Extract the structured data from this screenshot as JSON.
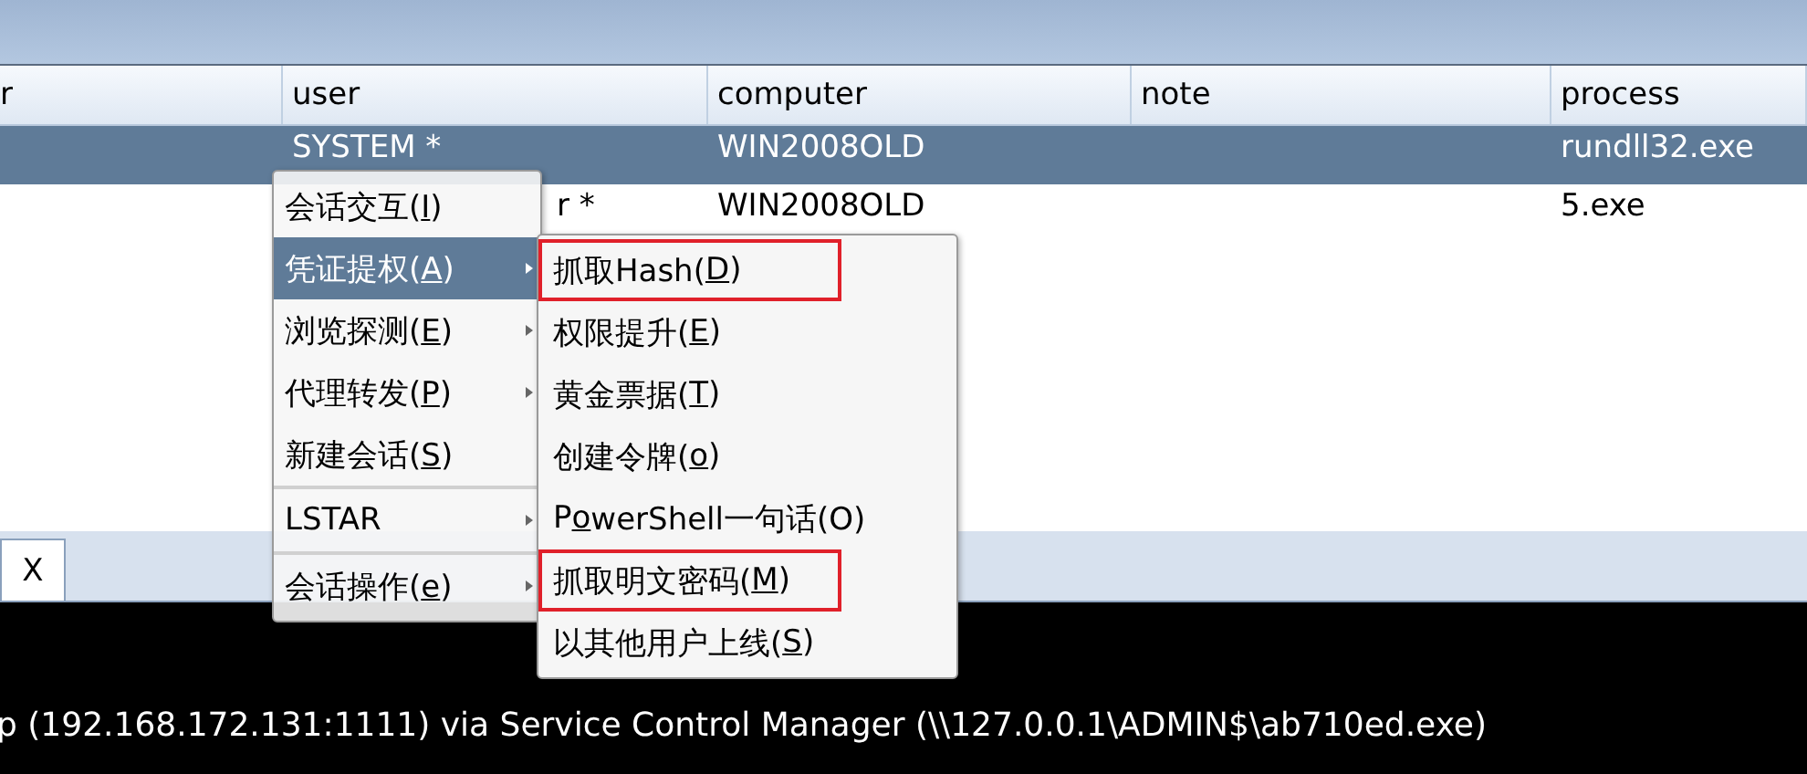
{
  "table": {
    "columns": [
      "r",
      "user",
      "computer",
      "note",
      "process"
    ],
    "rows": [
      {
        "selected": true,
        "cells": [
          "",
          "SYSTEM *",
          "WIN2008OLD",
          "",
          "rundll32.exe"
        ]
      },
      {
        "selected": false,
        "under_menu": true,
        "cells": [
          "",
          "r *",
          "WIN2008OLD",
          "",
          "5.exe"
        ]
      }
    ]
  },
  "tabs": [
    {
      "label": "X",
      "selected": true
    }
  ],
  "console": {
    "line": "p (192.168.172.131:1111) via Service Control Manager (\\\\127.0.0.1\\ADMIN$\\ab710ed.exe)"
  },
  "context_menu": {
    "items": [
      {
        "before": "会话交互(",
        "key": "I",
        "after": ")",
        "selected": false,
        "submenu": false,
        "separator_after": false
      },
      {
        "before": "凭证提权(",
        "key": "A",
        "after": ")",
        "selected": true,
        "submenu": true,
        "separator_after": false
      },
      {
        "before": "浏览探测(",
        "key": "E",
        "after": ")",
        "selected": false,
        "submenu": true,
        "separator_after": false
      },
      {
        "before": "代理转发(",
        "key": "P",
        "after": ")",
        "selected": false,
        "submenu": true,
        "separator_after": false
      },
      {
        "before": "新建会话(",
        "key": "S",
        "after": ")",
        "selected": false,
        "submenu": false,
        "separator_after": true
      },
      {
        "before": "LSTAR",
        "selected": false,
        "submenu": true,
        "separator_after": true
      },
      {
        "before": "会话操作(",
        "key": "e",
        "after": ")",
        "selected": false,
        "submenu": true,
        "separator_after": false
      }
    ]
  },
  "submenu": {
    "items": [
      {
        "before": "抓取Hash(",
        "key": "D",
        "after": ")",
        "marked": true
      },
      {
        "before": "权限提升(",
        "key": "E",
        "after": ")",
        "marked": false
      },
      {
        "before": "黄金票据(",
        "key": "T",
        "after": ")",
        "marked": false
      },
      {
        "before": "创建令牌(",
        "key": "o",
        "after": ")",
        "marked": false
      },
      {
        "before": "P",
        "key": "o",
        "after": "werShell一句话(O)",
        "marked": false
      },
      {
        "before": "抓取明文密码(",
        "key": "M",
        "after": ")",
        "marked": true
      },
      {
        "before": "以其他用户上线(",
        "key": "S",
        "after": ")",
        "marked": false
      }
    ]
  }
}
